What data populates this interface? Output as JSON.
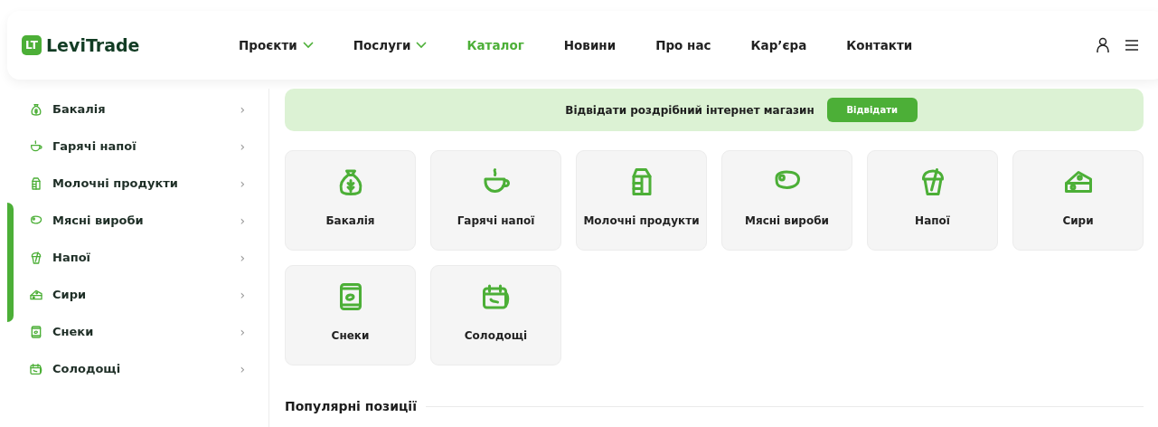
{
  "header": {
    "logo_badge": "LT",
    "logo_text": "LeviTrade",
    "nav": [
      {
        "label": "Проєкти",
        "dropdown": true,
        "selected": false
      },
      {
        "label": "Послуги",
        "dropdown": true,
        "selected": false
      },
      {
        "label": "Каталог",
        "dropdown": false,
        "selected": true
      },
      {
        "label": "Новини",
        "dropdown": false,
        "selected": false
      },
      {
        "label": "Про нас",
        "dropdown": false,
        "selected": false
      },
      {
        "label": "Кар’єра",
        "dropdown": false,
        "selected": false
      },
      {
        "label": "Контакти",
        "dropdown": false,
        "selected": false
      }
    ]
  },
  "sidebar": {
    "items": [
      {
        "label": "Бакалія",
        "chevron": "›"
      },
      {
        "label": "Гарячі напої",
        "chevron": "›"
      },
      {
        "label": "Молочні продукти",
        "chevron": "›"
      },
      {
        "label": "Мясні вироби",
        "chevron": "›"
      },
      {
        "label": "Напої",
        "chevron": "›"
      },
      {
        "label": "Сири",
        "chevron": "›"
      },
      {
        "label": "Снеки",
        "chevron": "›"
      },
      {
        "label": "Солодощі",
        "chevron": "›"
      }
    ]
  },
  "banner": {
    "text": "Відвідати роздрібний інтернет магазин",
    "button": "Відвідати"
  },
  "categories": [
    {
      "label": "Бакалія"
    },
    {
      "label": "Гарячі напої"
    },
    {
      "label": "Молочні продукти"
    },
    {
      "label": "Мясні вироби"
    },
    {
      "label": "Напої"
    },
    {
      "label": "Сири"
    },
    {
      "label": "Снеки"
    },
    {
      "label": "Солодощі"
    }
  ],
  "popular": {
    "title": "Популярні позиції"
  }
}
